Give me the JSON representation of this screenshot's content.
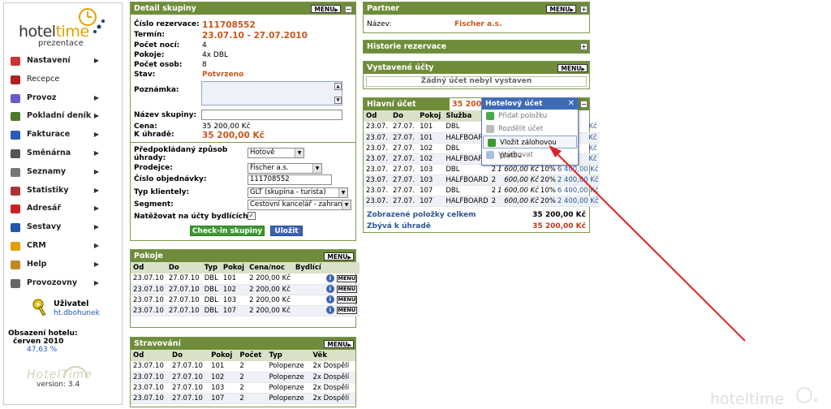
{
  "sidebar": {
    "logo_text_a": "hotel",
    "logo_text_b": "time",
    "logo_sub": "prezentace",
    "menu": [
      {
        "label": "Nastavení",
        "arrow": true,
        "icon": "settings-icon",
        "color": "#cc3333"
      },
      {
        "label": "Recepce",
        "arrow": false,
        "icon": "reception-icon",
        "color": "#aa2222"
      },
      {
        "label": "Provoz",
        "arrow": true,
        "icon": "operations-icon",
        "color": "#6a5acd"
      },
      {
        "label": "Pokladní deník",
        "arrow": true,
        "icon": "cashbook-icon",
        "color": "#4a7a2a"
      },
      {
        "label": "Fakturace",
        "arrow": true,
        "icon": "invoice-icon",
        "color": "#2a5ab5"
      },
      {
        "label": "Směnárna",
        "arrow": true,
        "icon": "exchange-icon",
        "color": "#555555"
      },
      {
        "label": "Seznamy",
        "arrow": true,
        "icon": "lists-icon",
        "color": "#777777"
      },
      {
        "label": "Statistiky",
        "arrow": true,
        "icon": "stats-icon",
        "color": "#aa3333"
      },
      {
        "label": "Adresář",
        "arrow": true,
        "icon": "addressbook-icon",
        "color": "#cc2222"
      },
      {
        "label": "Sestavy",
        "arrow": true,
        "icon": "reports-icon",
        "color": "#2255aa"
      },
      {
        "label": "CRM",
        "arrow": true,
        "icon": "crm-icon",
        "color": "#e0a000"
      },
      {
        "label": "Help",
        "arrow": true,
        "icon": "help-icon",
        "color": "#c08a20"
      },
      {
        "label": "Provozovny",
        "arrow": true,
        "icon": "branches-icon",
        "color": "#666666"
      }
    ],
    "user_label": "Uživatel",
    "user_name": "ht.dbohunek",
    "occupancy_label": "Obsazení hotelu:",
    "occupancy_month": "červen 2010",
    "occupancy_value": "47,63 %",
    "version_logo": "HotelTime",
    "version": "version: 3.4"
  },
  "detail": {
    "title": "Detail skupiny",
    "menu_label": "MENU",
    "fields": [
      {
        "label": "Číslo rezervace:",
        "value": "111708552",
        "style": "orange big"
      },
      {
        "label": "Termín:",
        "value": "23.07.10 - 27.07.2010",
        "style": "orange big"
      },
      {
        "label": "Počet nocí:",
        "value": "4",
        "style": ""
      },
      {
        "label": "Pokoje:",
        "value": "4x DBL",
        "style": ""
      },
      {
        "label": "Počet osob:",
        "value": "8",
        "style": ""
      },
      {
        "label": "Stav:",
        "value": "Potvrzeno",
        "style": "orange"
      }
    ],
    "note_label": "Poznámka:",
    "group_name_label": "Název skupiny:",
    "price_label": "Cena:",
    "price_value": "35 200,00 Kč",
    "due_label": "K úhradě:",
    "due_value": "35 200,00 Kč",
    "payment_label": "Předpokládaný způsob úhrady:",
    "payment_value": "Hotově",
    "seller_label": "Prodejce:",
    "seller_value": "Fischer a.s.",
    "order_label": "Číslo objednávky:",
    "order_value": "111708552",
    "client_label": "Typ klientely:",
    "client_value": "GLT (skupina - turista)",
    "segment_label": "Segment:",
    "segment_value": "Cestovní kancelář - zahran.",
    "charge_label": "Natěžovat na účty bydlících:",
    "checkin_button": "Check-in skupiny",
    "save_button": "Uložit"
  },
  "pokoje": {
    "title": "Pokoje",
    "menu_label": "MENU",
    "columns": [
      "Od",
      "Do",
      "Typ",
      "Pokoj",
      "Cena/noc",
      "Bydlící",
      ""
    ],
    "rows": [
      [
        "23.07.10",
        "27.07.10",
        "DBL",
        "101",
        "2 200,00 Kč"
      ],
      [
        "23.07.10",
        "27.07.10",
        "DBL",
        "102",
        "2 200,00 Kč"
      ],
      [
        "23.07.10",
        "27.07.10",
        "DBL",
        "103",
        "2 200,00 Kč"
      ],
      [
        "23.07.10",
        "27.07.10",
        "DBL",
        "107",
        "2 200,00 Kč"
      ]
    ],
    "row_menu": "MENU"
  },
  "stravovani": {
    "title": "Stravování",
    "menu_label": "MENU",
    "columns": [
      "Od",
      "Do",
      "Pokoj",
      "Počet",
      "Typ",
      "Věk"
    ],
    "rows": [
      [
        "23.07.10",
        "27.07.10",
        "101",
        "2",
        "Polopenze",
        "2x Dospělí"
      ],
      [
        "23.07.10",
        "27.07.10",
        "102",
        "2",
        "Polopenze",
        "2x Dospělí"
      ],
      [
        "23.07.10",
        "27.07.10",
        "103",
        "2",
        "Polopenze",
        "2x Dospělí"
      ],
      [
        "23.07.10",
        "27.07.10",
        "107",
        "2",
        "Polopenze",
        "2x Dospělí"
      ]
    ]
  },
  "partner": {
    "title": "Partner",
    "menu_label": "MENU",
    "name_label": "Název:",
    "name_value": "Fischer a.s."
  },
  "historie": {
    "title": "Historie rezervace"
  },
  "ucty": {
    "title": "Vystavené účty",
    "menu_label": "MENU",
    "empty": "Žádný účet nebyl vystaven"
  },
  "hlavni": {
    "title": "Hlavní účet",
    "amount": "35 200,0",
    "columns": [
      "Od",
      "Do",
      "Pokoj",
      "Služba"
    ],
    "rows": [
      {
        "od": "23.07.",
        "do": "27.07.",
        "pokoj": "101",
        "sluzba": "DBL",
        "tail": "Kč"
      },
      {
        "od": "23.07.",
        "do": "27.07.",
        "pokoj": "101",
        "sluzba": "HALFBOARD",
        "tail": "Kč"
      },
      {
        "od": "23.07.",
        "do": "27.07.",
        "pokoj": "102",
        "sluzba": "DBL",
        "tail": "Kč"
      },
      {
        "od": "23.07.",
        "do": "27.07.",
        "pokoj": "102",
        "sluzba": "HALFBOARD",
        "tail": "Kč"
      },
      {
        "od": "23.07.",
        "do": "27.07.",
        "pokoj": "103",
        "sluzba": "DBL",
        "qty": "2",
        "price": "1 600,00 Kč",
        "vat": "10%",
        "total": "6 400,00 Kč"
      },
      {
        "od": "23.07.",
        "do": "27.07.",
        "pokoj": "103",
        "sluzba": "HALFBOARD",
        "qty": "2",
        "price": "600,00 Kč",
        "vat": "20%",
        "total": "2 400,00 Kč"
      },
      {
        "od": "23.07.",
        "do": "27.07.",
        "pokoj": "107",
        "sluzba": "DBL",
        "qty": "2",
        "price": "1 600,00 Kč",
        "vat": "10%",
        "total": "6 400,00 Kč"
      },
      {
        "od": "23.07.",
        "do": "27.07.",
        "pokoj": "107",
        "sluzba": "HALFBOARD",
        "qty": "2",
        "price": "600,00 Kč",
        "vat": "20%",
        "total": "2 400,00 Kč"
      }
    ],
    "shown_label": "Zobrazené položky celkem",
    "shown_value": "35 200,00 Kč",
    "due_label": "Zbývá k úhradě",
    "due_value": "35 200,00 Kč"
  },
  "popup": {
    "title": "Hotelový účet",
    "items": [
      {
        "label": "Přidat položku",
        "icon": "add-icon",
        "color": "#4aa84a",
        "hl": false
      },
      {
        "label": "Rozdělit účet",
        "icon": "split-icon",
        "color": "#bbbbbb",
        "hl": false
      },
      {
        "label": "Vložit zálohovou platbu",
        "icon": "deposit-icon",
        "color": "#3d9a32",
        "hl": true
      },
      {
        "label": "Vyúčtovat",
        "icon": "settle-icon",
        "color": "#aac0e0",
        "hl": false
      }
    ]
  },
  "watermark": "hoteltime",
  "colors": {
    "panel_header": "#6f8c3b",
    "accent_orange": "#c8561a",
    "link_blue": "#2a5599",
    "arrow_red": "#dd2222"
  }
}
